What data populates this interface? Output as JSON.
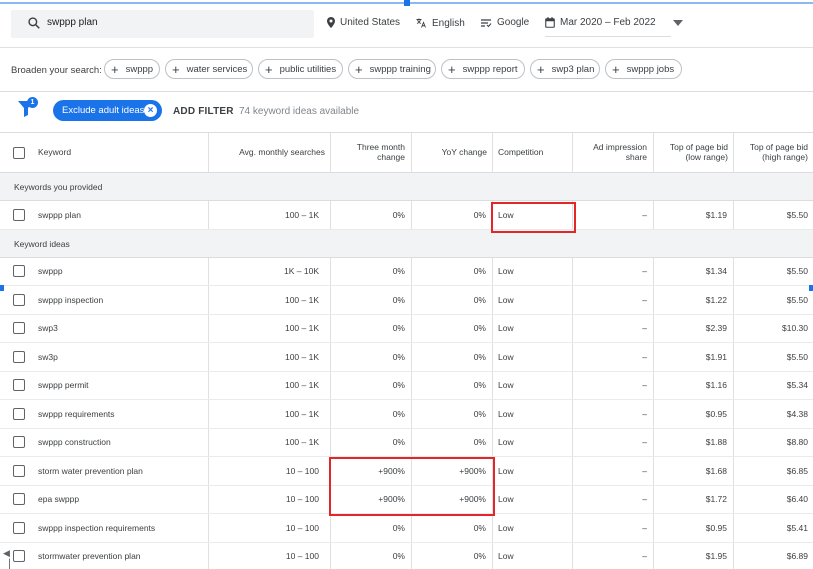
{
  "search": {
    "query": "swppp plan"
  },
  "topbar": {
    "location": "United States",
    "language": "English",
    "network": "Google",
    "date_range": "Mar 2020 – Feb 2022"
  },
  "broaden": {
    "label": "Broaden your search:",
    "chips": [
      "swppp",
      "water services",
      "public utilities",
      "swppp training",
      "swppp report",
      "swp3 plan",
      "swppp jobs"
    ]
  },
  "filters": {
    "badge_count": "1",
    "exclude_label": "Exclude adult ideas",
    "add_filter_label": "ADD FILTER",
    "available_text": "74 keyword ideas available"
  },
  "table": {
    "headers": {
      "keyword": "Keyword",
      "avg": "Avg. monthly searches",
      "three_month": "Three month change",
      "yoy": "YoY change",
      "competition": "Competition",
      "ad_share": "Ad impression share",
      "low_bid": "Top of page bid (low range)",
      "high_bid": "Top of page bid (high range)"
    },
    "provided_label": "Keywords you provided",
    "ideas_label": "Keyword ideas",
    "provided_rows": [
      {
        "keyword": "swppp plan",
        "avg": "100 – 1K",
        "three_month": "0%",
        "yoy": "0%",
        "competition": "Low",
        "ad_share": "–",
        "low_bid": "$1.19",
        "high_bid": "$5.50"
      }
    ],
    "idea_rows": [
      {
        "keyword": "swppp",
        "avg": "1K – 10K",
        "three_month": "0%",
        "yoy": "0%",
        "competition": "Low",
        "ad_share": "–",
        "low_bid": "$1.34",
        "high_bid": "$5.50"
      },
      {
        "keyword": "swppp inspection",
        "avg": "100 – 1K",
        "three_month": "0%",
        "yoy": "0%",
        "competition": "Low",
        "ad_share": "–",
        "low_bid": "$1.22",
        "high_bid": "$5.50"
      },
      {
        "keyword": "swp3",
        "avg": "100 – 1K",
        "three_month": "0%",
        "yoy": "0%",
        "competition": "Low",
        "ad_share": "–",
        "low_bid": "$2.39",
        "high_bid": "$10.30"
      },
      {
        "keyword": "sw3p",
        "avg": "100 – 1K",
        "three_month": "0%",
        "yoy": "0%",
        "competition": "Low",
        "ad_share": "–",
        "low_bid": "$1.91",
        "high_bid": "$5.50"
      },
      {
        "keyword": "swppp permit",
        "avg": "100 – 1K",
        "three_month": "0%",
        "yoy": "0%",
        "competition": "Low",
        "ad_share": "–",
        "low_bid": "$1.16",
        "high_bid": "$5.34"
      },
      {
        "keyword": "swppp requirements",
        "avg": "100 – 1K",
        "three_month": "0%",
        "yoy": "0%",
        "competition": "Low",
        "ad_share": "–",
        "low_bid": "$0.95",
        "high_bid": "$4.38"
      },
      {
        "keyword": "swppp construction",
        "avg": "100 – 1K",
        "three_month": "0%",
        "yoy": "0%",
        "competition": "Low",
        "ad_share": "–",
        "low_bid": "$1.88",
        "high_bid": "$8.80"
      },
      {
        "keyword": "storm water prevention plan",
        "avg": "10 – 100",
        "three_month": "+900%",
        "yoy": "+900%",
        "competition": "Low",
        "ad_share": "–",
        "low_bid": "$1.68",
        "high_bid": "$6.85"
      },
      {
        "keyword": "epa swppp",
        "avg": "10 – 100",
        "three_month": "+900%",
        "yoy": "+900%",
        "competition": "Low",
        "ad_share": "–",
        "low_bid": "$1.72",
        "high_bid": "$6.40"
      },
      {
        "keyword": "swppp inspection requirements",
        "avg": "10 – 100",
        "three_month": "0%",
        "yoy": "0%",
        "competition": "Low",
        "ad_share": "–",
        "low_bid": "$0.95",
        "high_bid": "$5.41"
      },
      {
        "keyword": "stormwater prevention plan",
        "avg": "10 – 100",
        "three_month": "0%",
        "yoy": "0%",
        "competition": "Low",
        "ad_share": "–",
        "low_bid": "$1.95",
        "high_bid": "$6.89"
      }
    ]
  },
  "colors": {
    "accent": "#1a73e8",
    "highlight": "#e32628",
    "group_bg": "#f1f3f4"
  }
}
